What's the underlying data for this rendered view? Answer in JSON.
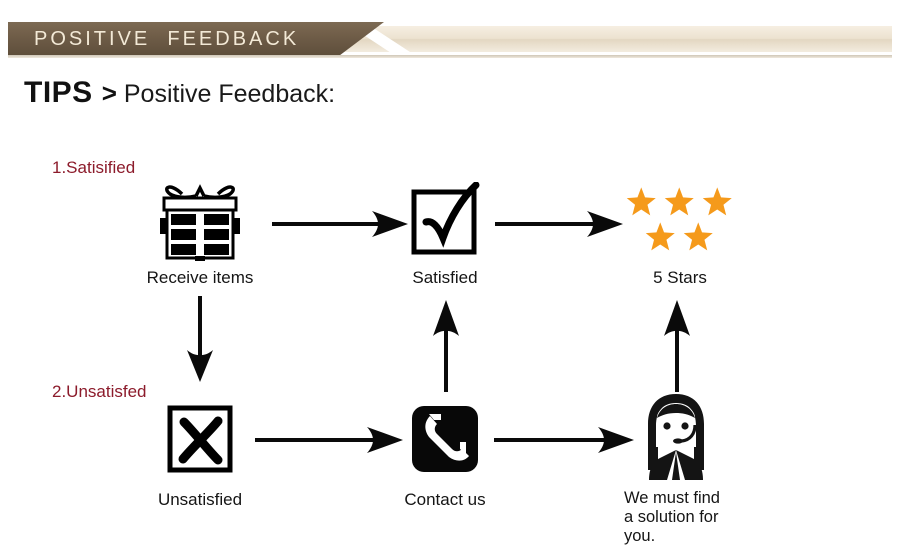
{
  "banner": {
    "title": "POSITIVE  FEEDBACK",
    "dark_color": "#6e5c47",
    "cream_color": "#ece2d0",
    "text_color": "#f3e9d6"
  },
  "heading": {
    "tips": "TIPS",
    "separator": ">",
    "subtitle": "Positive Feedback:"
  },
  "diagram": {
    "accent_red": "#8c1b2b",
    "star_color": "#f59a1b",
    "ink_color": "#151515",
    "steps": [
      {
        "number": "1.Satisified",
        "items": [
          {
            "icon": "gift-box-icon",
            "caption": "Receive items"
          },
          {
            "icon": "check-square-icon",
            "caption": "Satisfied"
          },
          {
            "icon": "five-stars-icon",
            "caption": "5 Stars"
          }
        ]
      },
      {
        "number": "2.Unsatisfed",
        "items": [
          {
            "icon": "x-square-icon",
            "caption": "Unsatisfied"
          },
          {
            "icon": "telephone-icon",
            "caption": "Contact us"
          },
          {
            "icon": "support-agent-icon",
            "caption": "We must find\na solution for\nyou."
          }
        ]
      }
    ],
    "stars_count": 5
  }
}
